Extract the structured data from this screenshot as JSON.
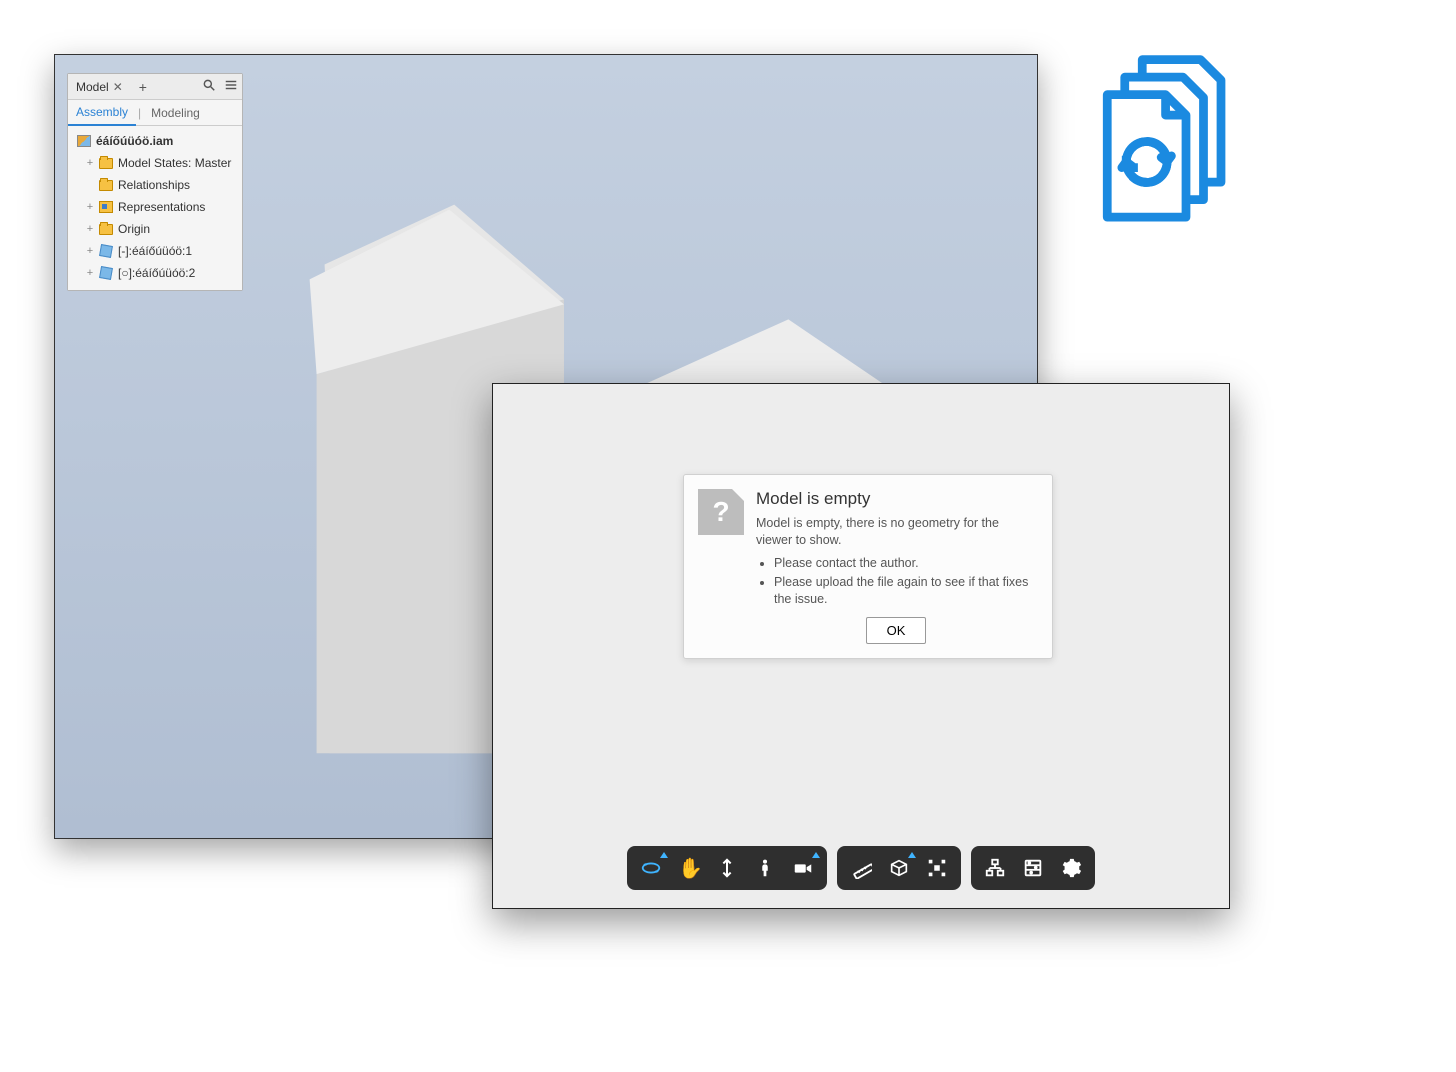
{
  "modelPanel": {
    "tabLabel": "Model",
    "subtabs": {
      "assembly": "Assembly",
      "modeling": "Modeling"
    },
    "tree": {
      "root": "éáíőúüóö.iam",
      "modelStates": "Model States: Master",
      "relationships": "Relationships",
      "representations": "Representations",
      "origin": "Origin",
      "part1": "[-]:éáíőúüóö:1",
      "part2": "[○]:éáíőúüóö:2"
    }
  },
  "errorDialog": {
    "title": "Model is empty",
    "message": "Model is empty, there is no geometry for the viewer to show.",
    "bullet1": "Please contact the author.",
    "bullet2": "Please upload the file again to see if that fixes the issue.",
    "okLabel": "OK"
  },
  "toolbar": {
    "group1": [
      "orbit",
      "pan",
      "zoom",
      "walk",
      "camera"
    ],
    "group2": [
      "measure",
      "section",
      "explode"
    ],
    "group3": [
      "model-browser",
      "properties",
      "settings"
    ]
  }
}
